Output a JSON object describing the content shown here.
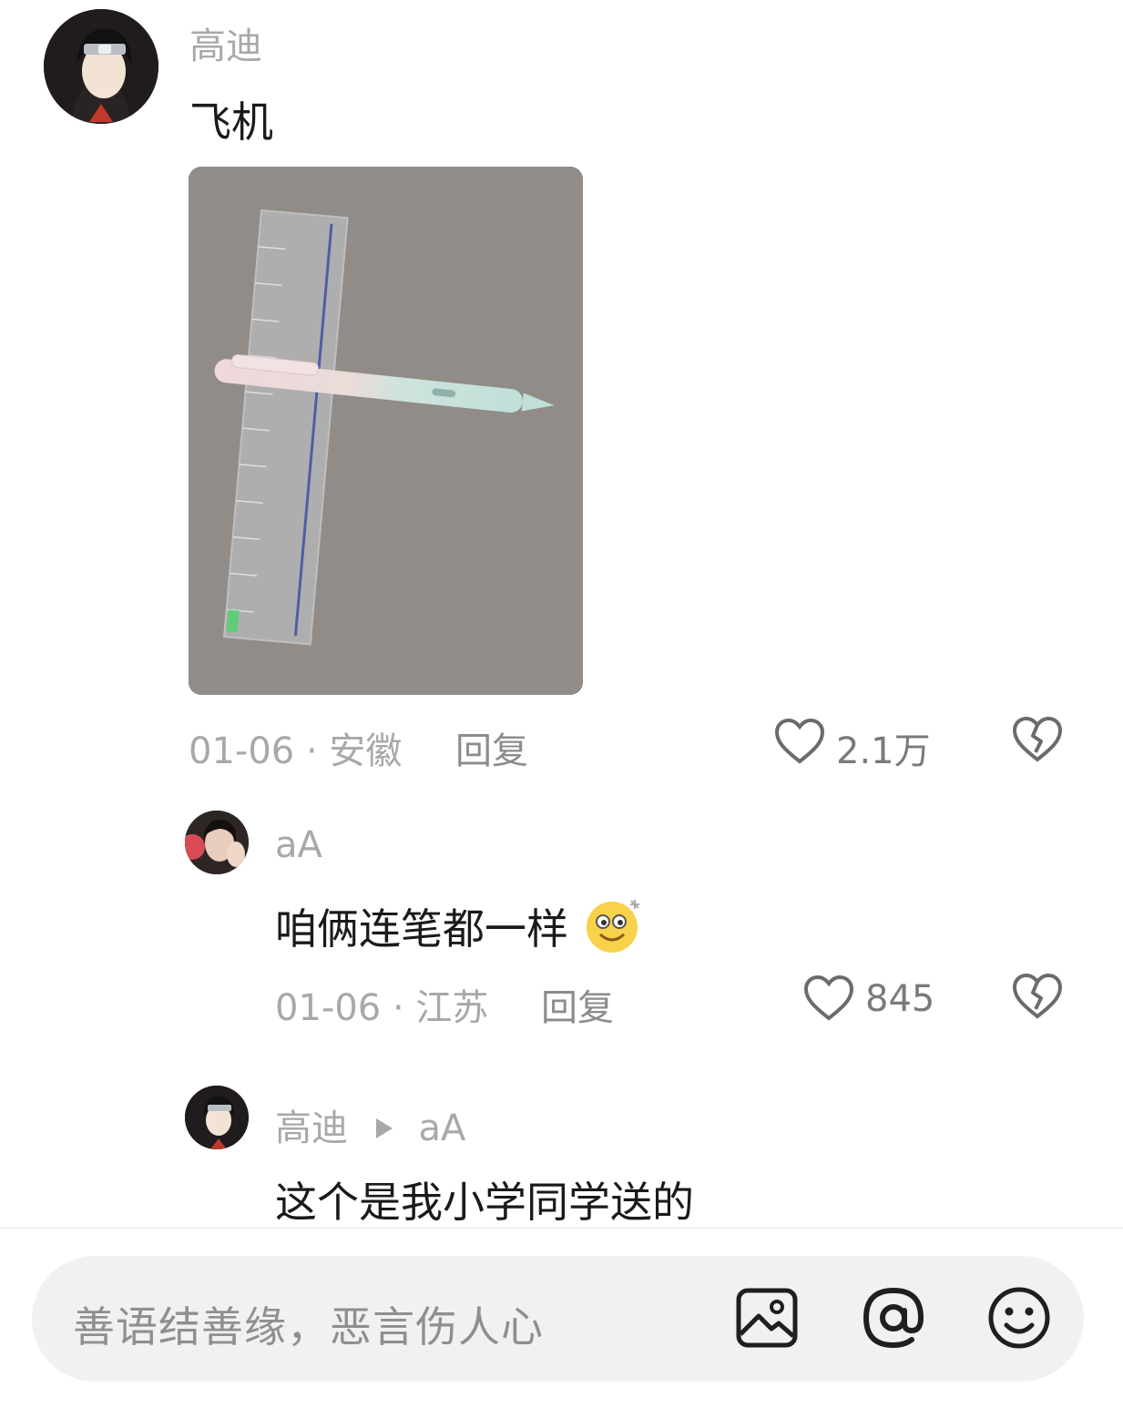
{
  "comments": [
    {
      "author": "高迪",
      "text": "飞机",
      "date_location": "01-06 · 安徽",
      "reply_label": "回复",
      "likes": "2.1万"
    },
    {
      "author": "aA",
      "text": "咱俩连笔都一样",
      "date_location": "01-06 · 江苏",
      "reply_label": "回复",
      "likes": "845"
    },
    {
      "author": "高迪",
      "reply_to": "aA",
      "text": "这个是我小学同学送的"
    }
  ],
  "input": {
    "placeholder": "善语结善缘，恶言伤人心"
  },
  "icons": [
    "heart-icon",
    "dislike-broken-heart-icon",
    "image-icon",
    "at-mention-icon",
    "emoji-icon"
  ],
  "colors": {
    "muted_text": "#a8a8a8",
    "body_text": "#1a1a1a",
    "input_bg": "#f1f1f1"
  }
}
